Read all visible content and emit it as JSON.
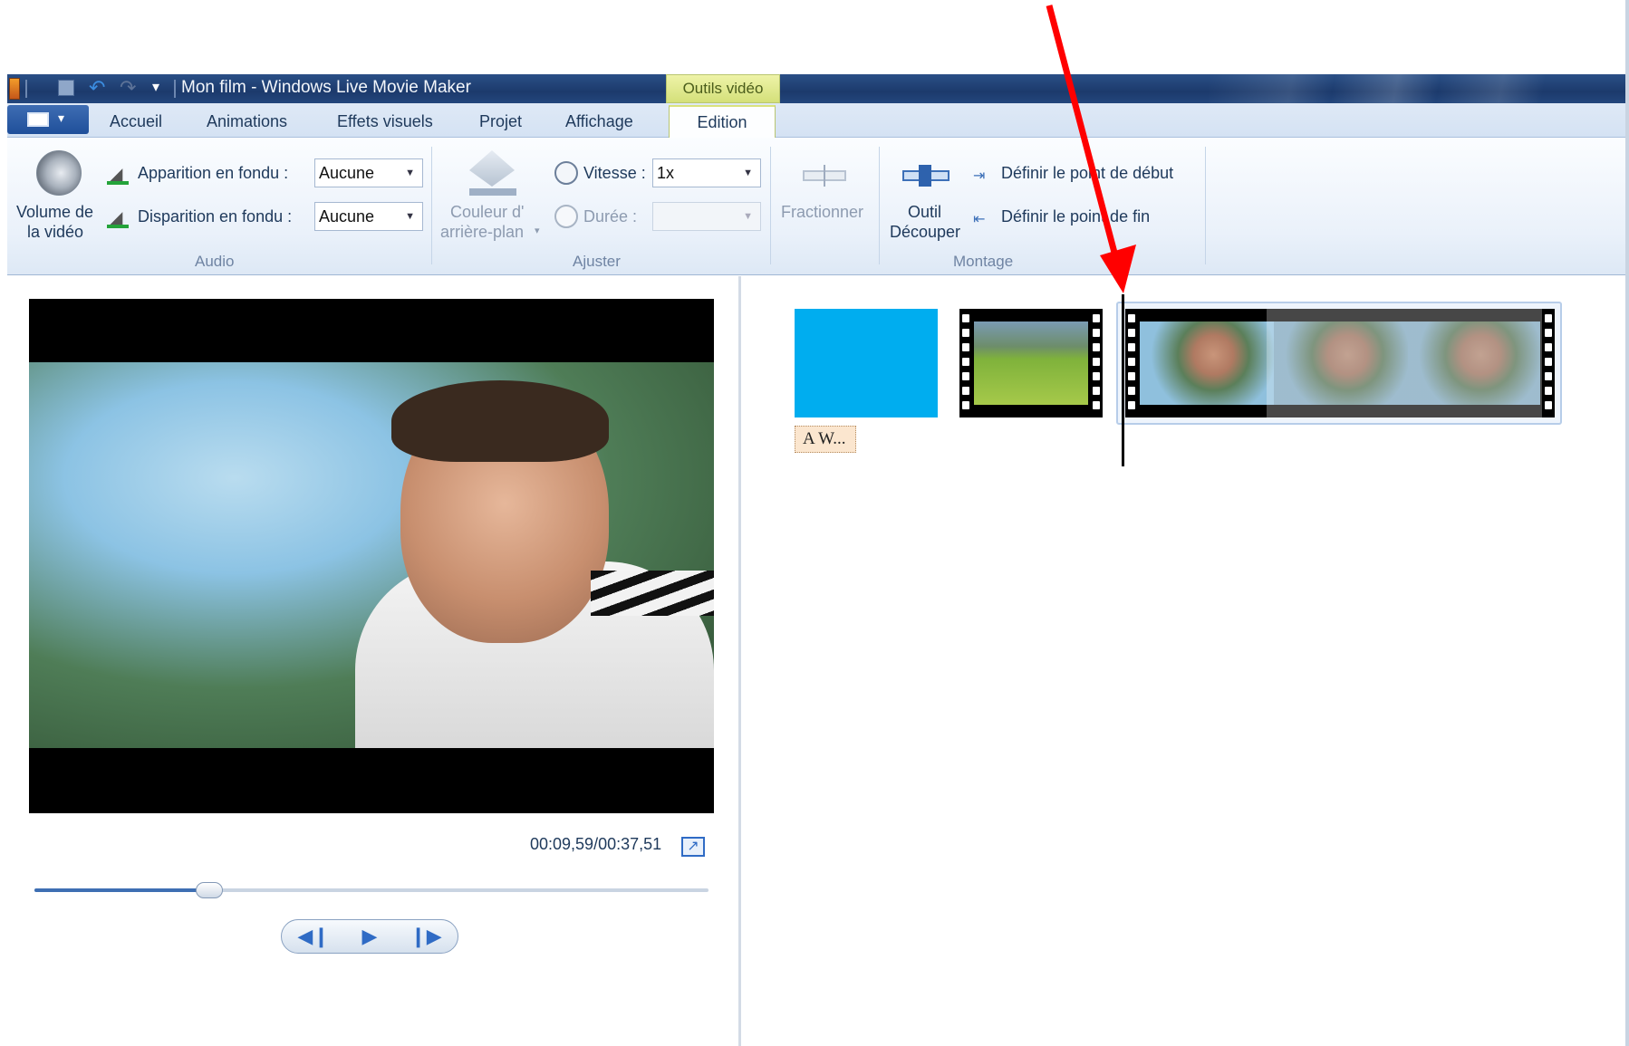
{
  "window": {
    "title": "Mon film - Windows Live Movie Maker",
    "context_tab": "Outils vidéo"
  },
  "tabs": [
    {
      "label": "Accueil"
    },
    {
      "label": "Animations"
    },
    {
      "label": "Effets visuels"
    },
    {
      "label": "Projet"
    },
    {
      "label": "Affichage"
    },
    {
      "label": "Edition"
    }
  ],
  "ribbon": {
    "audio": {
      "group_label": "Audio",
      "volume_line1": "Volume de",
      "volume_line2": "la vidéo",
      "fade_in_label": "Apparition en fondu :",
      "fade_in_value": "Aucune",
      "fade_out_label": "Disparition en fondu :",
      "fade_out_value": "Aucune"
    },
    "adjust": {
      "group_label": "Ajuster",
      "bg_color_line1": "Couleur d'",
      "bg_color_line2": "arrière-plan",
      "speed_label": "Vitesse :",
      "speed_value": "1x",
      "duration_label": "Durée :",
      "duration_value": ""
    },
    "montage": {
      "group_label": "Montage",
      "split_label": "Fractionner",
      "trim_line1": "Outil",
      "trim_line2": "Découper",
      "set_start": "Définir le point de début",
      "set_end": "Définir le point de fin"
    }
  },
  "preview": {
    "time": "00:09,59/00:37,51",
    "progress": 0.26
  },
  "storyboard": {
    "caption_label": "A W..."
  },
  "colors": {
    "accent": "#3e6fb3",
    "title_clip": "#00adef",
    "annotation_arrow": "#ff0000"
  }
}
